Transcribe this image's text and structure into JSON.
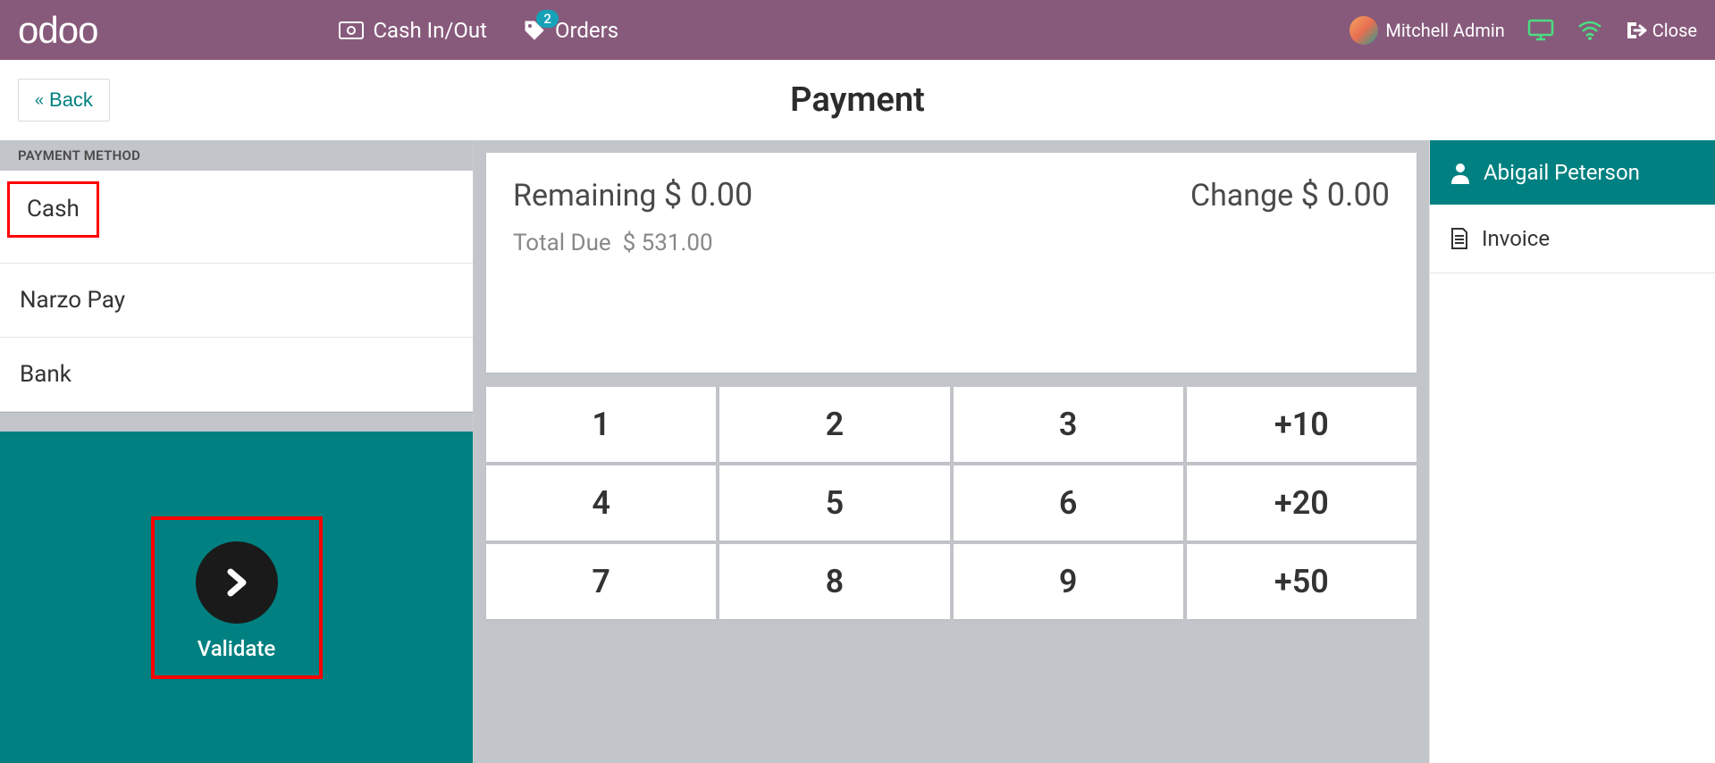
{
  "topbar": {
    "logo_text": "odoo",
    "cash_in_out_label": "Cash In/Out",
    "orders_label": "Orders",
    "orders_badge": "2",
    "user_name": "Mitchell Admin",
    "close_label": "Close"
  },
  "subheader": {
    "back_label": "Back",
    "page_title": "Payment"
  },
  "payment_methods": {
    "header": "PAYMENT METHOD",
    "items": [
      "Cash",
      "Narzo Pay",
      "Bank"
    ]
  },
  "validate": {
    "label": "Validate"
  },
  "status": {
    "remaining_label": "Remaining",
    "remaining_value": "$ 0.00",
    "change_label": "Change",
    "change_value": "$ 0.00",
    "total_due_label": "Total Due",
    "total_due_value": "$ 531.00"
  },
  "keypad": {
    "rows": [
      [
        "1",
        "2",
        "3",
        "+10"
      ],
      [
        "4",
        "5",
        "6",
        "+20"
      ],
      [
        "7",
        "8",
        "9",
        "+50"
      ]
    ]
  },
  "right": {
    "customer_name": "Abigail Peterson",
    "invoice_label": "Invoice"
  }
}
